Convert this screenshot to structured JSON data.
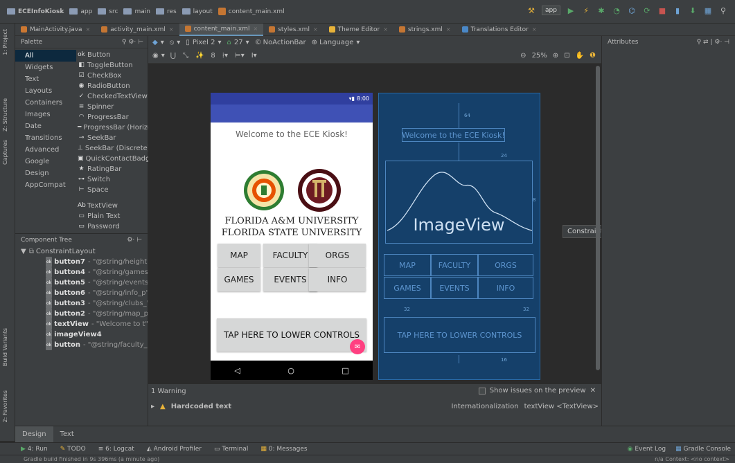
{
  "breadcrumbs": [
    "ECEInfoKiosk",
    "app",
    "src",
    "main",
    "res",
    "layout",
    "content_main.xml"
  ],
  "run_config": "app",
  "left_strip": {
    "project": "1: Project",
    "structure": "Z: Structure",
    "captures": "Captures",
    "build_variants": "Build Variants",
    "favorites": "2: Favorites"
  },
  "editor_tabs": [
    {
      "label": "MainActivity.java",
      "color": "#cc7832",
      "active": false
    },
    {
      "label": "activity_main.xml",
      "color": "#c57633",
      "active": false
    },
    {
      "label": "content_main.xml",
      "color": "#c57633",
      "active": true
    },
    {
      "label": "styles.xml",
      "color": "#c57633",
      "active": false
    },
    {
      "label": "Theme Editor",
      "color": "#e8b339",
      "active": false
    },
    {
      "label": "strings.xml",
      "color": "#c57633",
      "active": false
    },
    {
      "label": "Translations Editor",
      "color": "#4a88c7",
      "active": false
    }
  ],
  "palette": {
    "title": "Palette",
    "categories": [
      "All",
      "Widgets",
      "Text",
      "Layouts",
      "Containers",
      "Images",
      "Date",
      "Transitions",
      "Advanced",
      "Google",
      "Design",
      "AppCompat"
    ],
    "items": [
      {
        "icon": "ok",
        "label": "Button"
      },
      {
        "icon": "◧",
        "label": "ToggleButton"
      },
      {
        "icon": "☑",
        "label": "CheckBox"
      },
      {
        "icon": "◉",
        "label": "RadioButton"
      },
      {
        "icon": "✓",
        "label": "CheckedTextView"
      },
      {
        "icon": "≡",
        "label": "Spinner"
      },
      {
        "icon": "◠",
        "label": "ProgressBar"
      },
      {
        "icon": "━",
        "label": "ProgressBar (Horizontal)"
      },
      {
        "icon": "⊸",
        "label": "SeekBar"
      },
      {
        "icon": "⊥",
        "label": "SeekBar (Discrete)"
      },
      {
        "icon": "▣",
        "label": "QuickContactBadge"
      },
      {
        "icon": "★",
        "label": "RatingBar"
      },
      {
        "icon": "⊶",
        "label": "Switch"
      },
      {
        "icon": "⊢",
        "label": "Space"
      }
    ],
    "items2": [
      {
        "icon": "Ab",
        "label": "TextView"
      },
      {
        "icon": "▭",
        "label": "Plain Text"
      },
      {
        "icon": "▭",
        "label": "Password"
      }
    ]
  },
  "component_tree": {
    "title": "Component Tree",
    "root": "ConstraintLayout",
    "nodes": [
      {
        "name": "button7",
        "value": "- \"@string/height\""
      },
      {
        "name": "button4",
        "value": "- \"@string/games\""
      },
      {
        "name": "button5",
        "value": "- \"@string/events\""
      },
      {
        "name": "button6",
        "value": "- \"@string/info_p\""
      },
      {
        "name": "button3",
        "value": "- \"@string/clubs_\""
      },
      {
        "name": "button2",
        "value": "- \"@string/map_p\""
      },
      {
        "name": "textView",
        "value": "- \"Welcome to t\""
      },
      {
        "name": "imageView4",
        "value": ""
      },
      {
        "name": "button",
        "value": "- \"@string/faculty_\""
      }
    ]
  },
  "design_toolbar": {
    "device": "Pixel 2",
    "api": "27",
    "theme": "NoActionBar",
    "language": "Language",
    "zoom": "25%",
    "number": "8"
  },
  "preview": {
    "time": "8:00",
    "welcome": "Welcome to the ECE Kiosk!",
    "univ1": "FLORIDA A&M UNIVERSITY",
    "univ2": "FLORIDA STATE UNIVERSITY",
    "buttons": [
      "MAP",
      "FACULTY",
      "ORGS",
      "GAMES",
      "EVENTS",
      "INFO"
    ],
    "tap": "TAP HERE TO LOWER CONTROLS",
    "nav": [
      "◁",
      "○",
      "□"
    ]
  },
  "blueprint": {
    "welcome": "Welcome to the ECE Kiosk!",
    "image": "ImageView",
    "buttons": [
      "MAP",
      "FACULTY",
      "ORGS",
      "GAMES",
      "EVENTS",
      "INFO"
    ],
    "tap": "TAP HERE TO LOWER CONTROLS",
    "margins": [
      "64",
      "24",
      "8",
      "32",
      "32",
      "16",
      "16",
      "16"
    ]
  },
  "tooltip": "ConstraintLayout",
  "attributes": {
    "title": "Attributes"
  },
  "issues": {
    "count": "1 Warning",
    "show": "Show issues on the preview",
    "title": "Hardcoded text",
    "category": "Internationalization",
    "target": "textView <TextView>"
  },
  "design_tabs": [
    "Design",
    "Text"
  ],
  "tool_windows": [
    "4: Run",
    "TODO",
    "6: Logcat",
    "Android Profiler",
    "Terminal",
    "0: Messages"
  ],
  "right_tools": [
    "Event Log",
    "Gradle Console"
  ],
  "status": "Gradle build finished in 9s 396ms (a minute ago)",
  "status_right": "n/a   Context: <no context>"
}
